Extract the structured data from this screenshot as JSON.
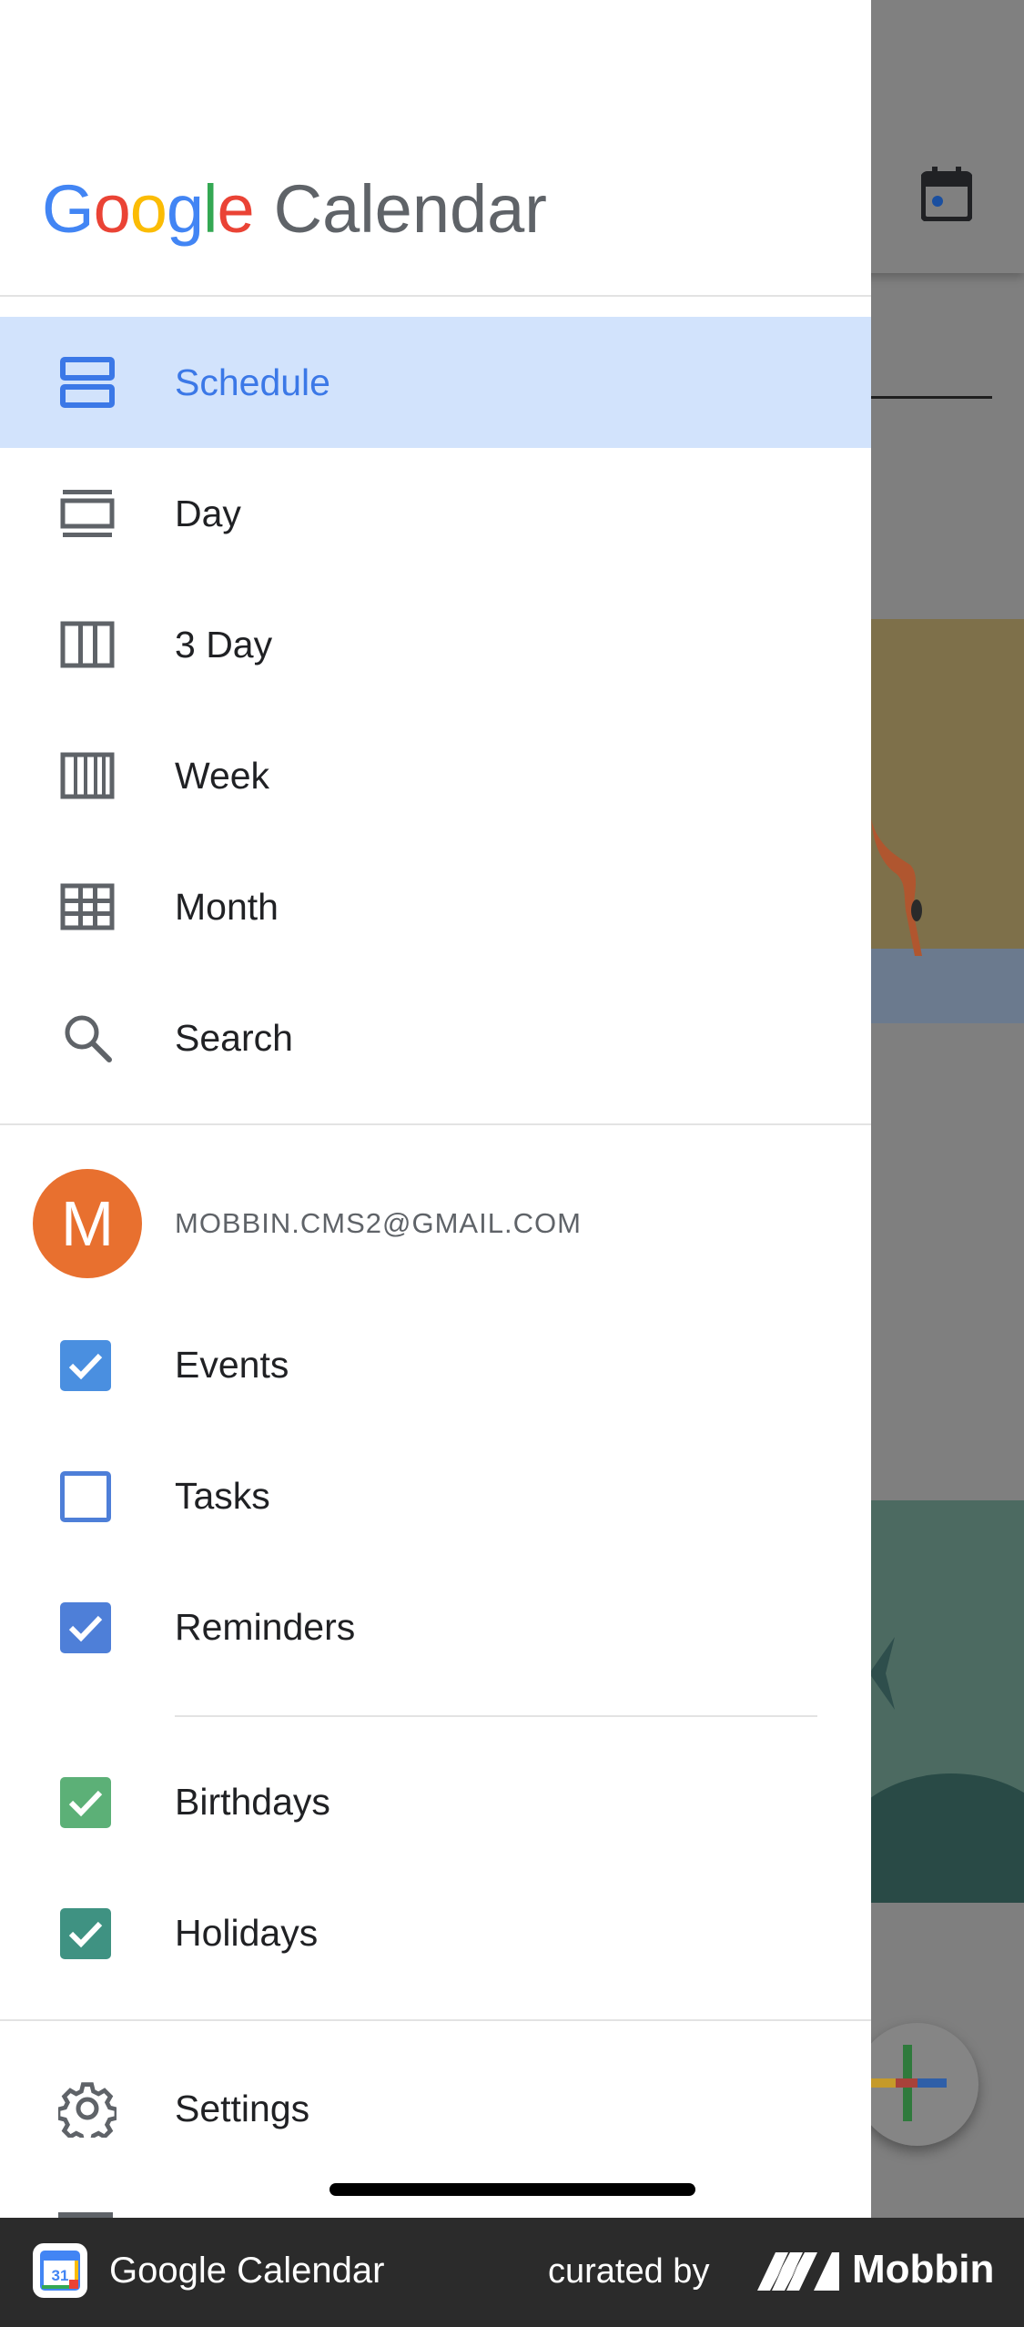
{
  "app": {
    "brand_google": [
      "G",
      "o",
      "o",
      "g",
      "l",
      "e"
    ],
    "brand_colors": [
      "#4285F4",
      "#EA4335",
      "#FBBC05",
      "#4285F4",
      "#34A853",
      "#EA4335"
    ],
    "brand_product": "Calendar"
  },
  "nav": {
    "items": [
      {
        "label": "Schedule",
        "icon": "schedule-icon",
        "active": true
      },
      {
        "label": "Day",
        "icon": "day-icon",
        "active": false
      },
      {
        "label": "3 Day",
        "icon": "three-day-icon",
        "active": false
      },
      {
        "label": "Week",
        "icon": "week-icon",
        "active": false
      },
      {
        "label": "Month",
        "icon": "month-icon",
        "active": false
      },
      {
        "label": "Search",
        "icon": "search-icon",
        "active": false
      }
    ]
  },
  "account": {
    "initial": "M",
    "email": "MOBBIN.CMS2@GMAIL.COM",
    "avatar_color": "#E8702F"
  },
  "calendars": [
    {
      "label": "Events",
      "checked": true,
      "color": "#4A8FE0"
    },
    {
      "label": "Tasks",
      "checked": false,
      "color": "#4E7FD8"
    },
    {
      "label": "Reminders",
      "checked": true,
      "color": "#4E7FD8"
    },
    {
      "label": "Birthdays",
      "checked": true,
      "color": "#5CB077"
    },
    {
      "label": "Holidays",
      "checked": true,
      "color": "#3F9282"
    }
  ],
  "settings": {
    "label": "Settings",
    "icon": "gear-icon"
  },
  "footer": {
    "app_name": "Google Calendar",
    "curated_by": "curated by",
    "brand": "Mobbin"
  }
}
